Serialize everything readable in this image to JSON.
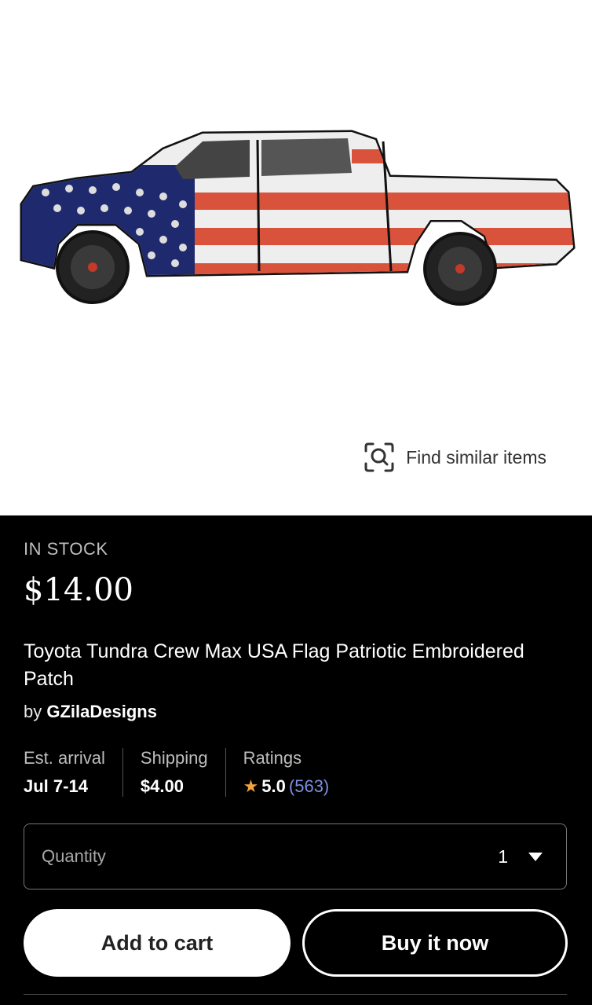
{
  "find_similar": {
    "label": "Find similar items",
    "icon": "visual-search-icon"
  },
  "product": {
    "stock_status": "IN STOCK",
    "price": "$14.00",
    "title": "Toyota Tundra Crew Max USA Flag Patriotic Embroidered Patch",
    "by_prefix": "by",
    "seller": "GZilaDesigns"
  },
  "stats": {
    "arrival": {
      "label": "Est. arrival",
      "value": "Jul 7-14"
    },
    "shipping": {
      "label": "Shipping",
      "value": "$4.00"
    },
    "ratings": {
      "label": "Ratings",
      "value": "5.0",
      "count": "(563)",
      "icon": "star-icon"
    }
  },
  "quantity": {
    "label": "Quantity",
    "value": "1"
  },
  "actions": {
    "add_to_cart": "Add to cart",
    "buy_now": "Buy it now"
  },
  "colors": {
    "accent_star": "#f1a33d",
    "link": "#7b8fe0",
    "background": "#000000"
  }
}
